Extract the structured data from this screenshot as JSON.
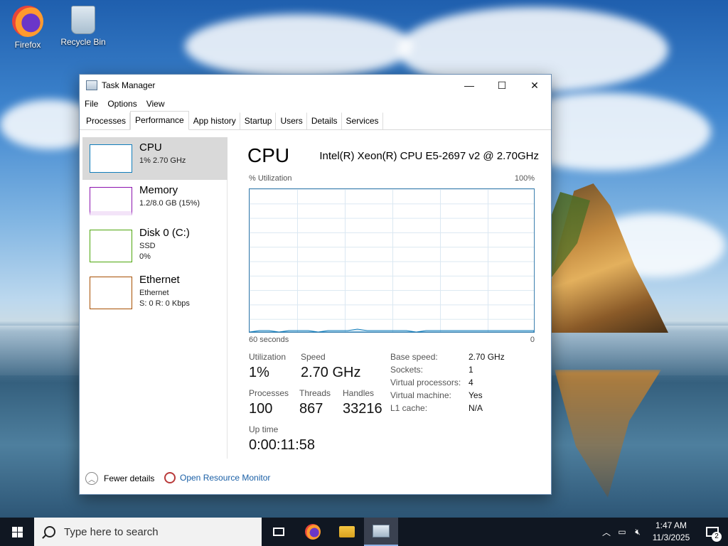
{
  "desktop": {
    "icons": [
      {
        "label": "Firefox"
      },
      {
        "label": "Recycle Bin"
      }
    ]
  },
  "window": {
    "title": "Task Manager",
    "controls": {
      "minimize": "—",
      "maximize": "☐",
      "close": "✕"
    },
    "menu": [
      "File",
      "Options",
      "View"
    ],
    "tabs": [
      "Processes",
      "Performance",
      "App history",
      "Startup",
      "Users",
      "Details",
      "Services"
    ],
    "active_tab": "Performance"
  },
  "resources": [
    {
      "name": "CPU",
      "sub1": "1% 2.70 GHz",
      "color": "#117dbb"
    },
    {
      "name": "Memory",
      "sub1": "1.2/8.0 GB (15%)",
      "color": "#8b12ae"
    },
    {
      "name": "Disk 0 (C:)",
      "sub1": "SSD",
      "sub2": "0%",
      "color": "#4da60c"
    },
    {
      "name": "Ethernet",
      "sub1": "Ethernet",
      "sub2": "S: 0 R: 0 Kbps",
      "color": "#a74f01"
    }
  ],
  "detail": {
    "title": "CPU",
    "model": "Intel(R) Xeon(R) CPU E5-2697 v2 @ 2.70GHz",
    "graph": {
      "y_label": "% Utilization",
      "y_max_label": "100%",
      "x_label": "60 seconds",
      "x_min_label": "0",
      "utilization_percent_history": [
        0,
        1,
        1,
        0,
        1,
        1,
        1,
        0,
        1,
        1,
        1,
        2,
        1,
        1,
        1,
        1,
        1,
        0,
        1,
        1,
        1,
        1,
        1,
        1,
        1,
        1,
        1,
        1,
        1,
        1
      ]
    },
    "stats": {
      "utilization_label": "Utilization",
      "utilization": "1%",
      "speed_label": "Speed",
      "speed": "2.70 GHz",
      "processes_label": "Processes",
      "processes": "100",
      "threads_label": "Threads",
      "threads": "867",
      "handles_label": "Handles",
      "handles": "33216",
      "uptime_label": "Up time",
      "uptime": "0:00:11:58"
    },
    "specs": [
      {
        "label": "Base speed:",
        "value": "2.70 GHz"
      },
      {
        "label": "Sockets:",
        "value": "1"
      },
      {
        "label": "Virtual processors:",
        "value": "4"
      },
      {
        "label": "Virtual machine:",
        "value": "Yes"
      },
      {
        "label": "L1 cache:",
        "value": "N/A"
      }
    ]
  },
  "footer": {
    "fewer_details": "Fewer details",
    "open_resource_monitor": "Open Resource Monitor"
  },
  "taskbar": {
    "search_placeholder": "Type here to search",
    "clock_time": "1:47 AM",
    "clock_date": "11/3/2025",
    "notification_count": "2"
  }
}
